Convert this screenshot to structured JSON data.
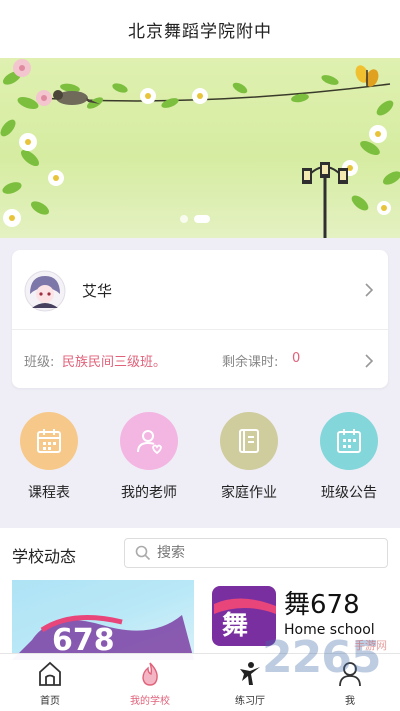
{
  "header": {
    "title": "北京舞蹈学院附中"
  },
  "banner": {
    "slides": 2,
    "active_index": 1
  },
  "profile": {
    "name": "艾华",
    "avatar_icon": "avatar-girl-icon"
  },
  "class_info": {
    "class_label": "班级:",
    "class_value": "民族民间三级班。",
    "remaining_label": "剩余课时:",
    "remaining_value": "0"
  },
  "shortcuts": [
    {
      "label": "课程表",
      "icon": "calendar-icon",
      "color": "#f6c98a"
    },
    {
      "label": "我的老师",
      "icon": "teacher-icon",
      "color": "#f3b6e2"
    },
    {
      "label": "家庭作业",
      "icon": "notebook-icon",
      "color": "#cfcc9e"
    },
    {
      "label": "班级公告",
      "icon": "calendar-list-icon",
      "color": "#83d6d9"
    }
  ],
  "news": {
    "title": "学校动态",
    "search_placeholder": "搜索",
    "brand_text": "舞678",
    "brand_sub": "Home school",
    "card_logo_text": "678"
  },
  "tabbar": [
    {
      "label": "首页",
      "icon": "home-icon",
      "active": false
    },
    {
      "label": "我的学校",
      "icon": "flame-icon",
      "active": true
    },
    {
      "label": "练习厅",
      "icon": "dancer-icon",
      "active": false
    },
    {
      "label": "我",
      "icon": "person-icon",
      "active": false
    }
  ],
  "watermark": {
    "text": "2265",
    "sub": "手游网"
  },
  "colors": {
    "accent": "#e0627a",
    "background": "#efeef6"
  }
}
